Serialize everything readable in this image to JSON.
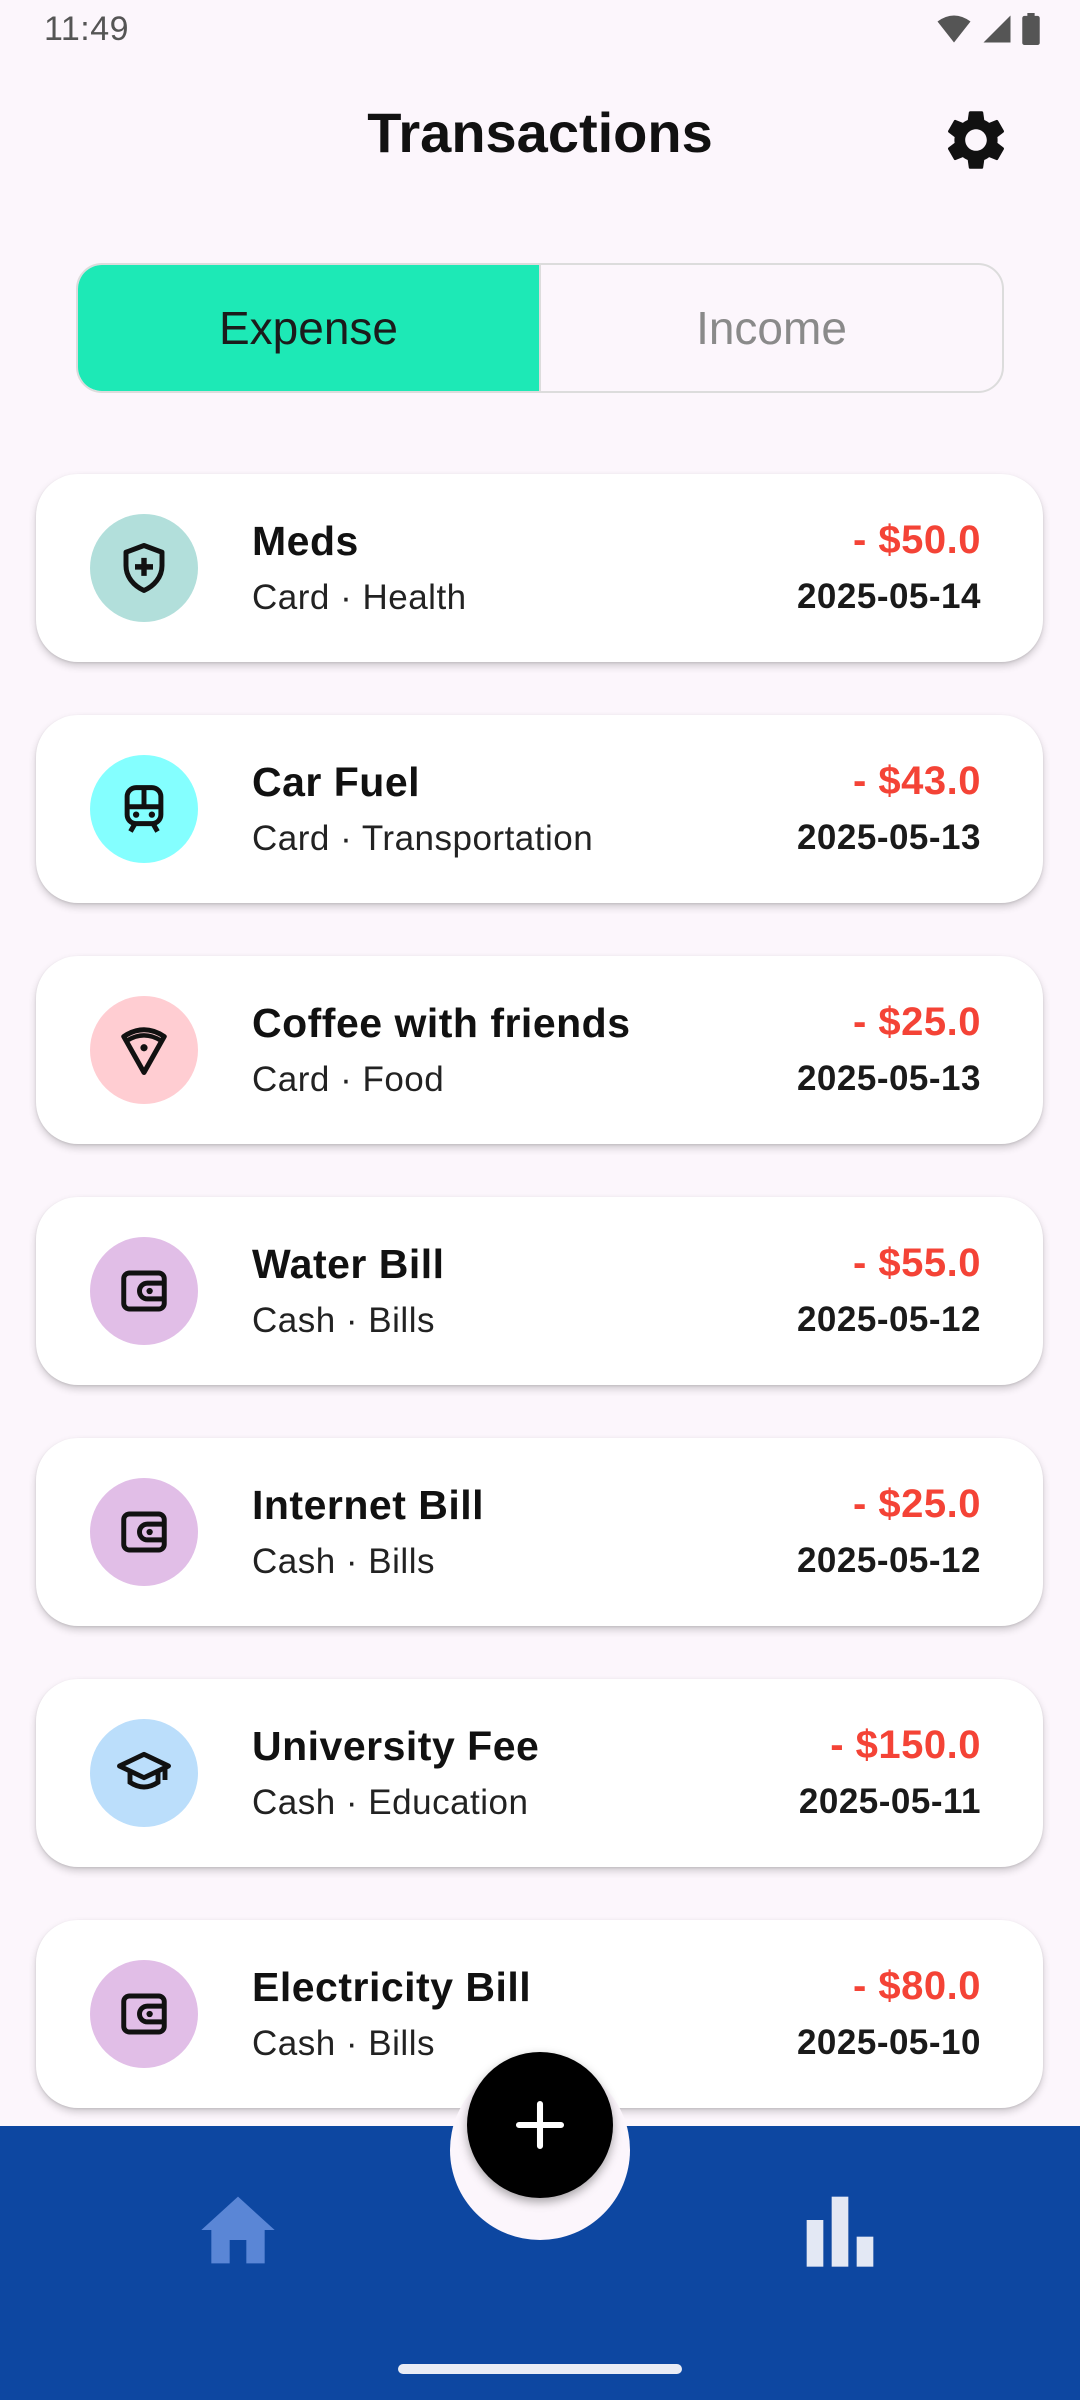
{
  "status_bar": {
    "time": "11:49"
  },
  "header": {
    "title": "Transactions"
  },
  "tabs": [
    {
      "label": "Expense",
      "active": true
    },
    {
      "label": "Income",
      "active": false
    }
  ],
  "transactions": [
    {
      "title": "Meds",
      "subtitle": "Card · Health",
      "amount": "- $50.0",
      "date": "2025-05-14",
      "icon": "shield-plus-icon",
      "icon_bg": "#B2DFDB"
    },
    {
      "title": "Car Fuel",
      "subtitle": "Card · Transportation",
      "amount": "- $43.0",
      "date": "2025-05-13",
      "icon": "train-icon",
      "icon_bg": "#84FFFF"
    },
    {
      "title": "Coffee with friends",
      "subtitle": "Card · Food",
      "amount": "- $25.0",
      "date": "2025-05-13",
      "icon": "pizza-icon",
      "icon_bg": "#FFCDD2"
    },
    {
      "title": "Water Bill",
      "subtitle": "Cash · Bills",
      "amount": "- $55.0",
      "date": "2025-05-12",
      "icon": "wallet-icon",
      "icon_bg": "#E1BEE7"
    },
    {
      "title": "Internet Bill",
      "subtitle": "Cash · Bills",
      "amount": "- $25.0",
      "date": "2025-05-12",
      "icon": "wallet-icon",
      "icon_bg": "#E1BEE7"
    },
    {
      "title": "University Fee",
      "subtitle": "Cash · Education",
      "amount": "- $150.0",
      "date": "2025-05-11",
      "icon": "graduation-cap-icon",
      "icon_bg": "#BBDEFB"
    },
    {
      "title": "Electricity Bill",
      "subtitle": "Cash · Bills",
      "amount": "- $80.0",
      "date": "2025-05-10",
      "icon": "wallet-icon",
      "icon_bg": "#E1BEE7"
    }
  ],
  "colors": {
    "accent_active_tab": "#1DE9B6",
    "expense_amount": "#F44336",
    "bottom_bar": "#0D47A1",
    "fab": "#000000"
  },
  "nav": {
    "items": [
      {
        "icon": "home-icon"
      },
      {
        "icon": "bar-chart-icon"
      }
    ],
    "fab_icon": "plus-icon"
  }
}
